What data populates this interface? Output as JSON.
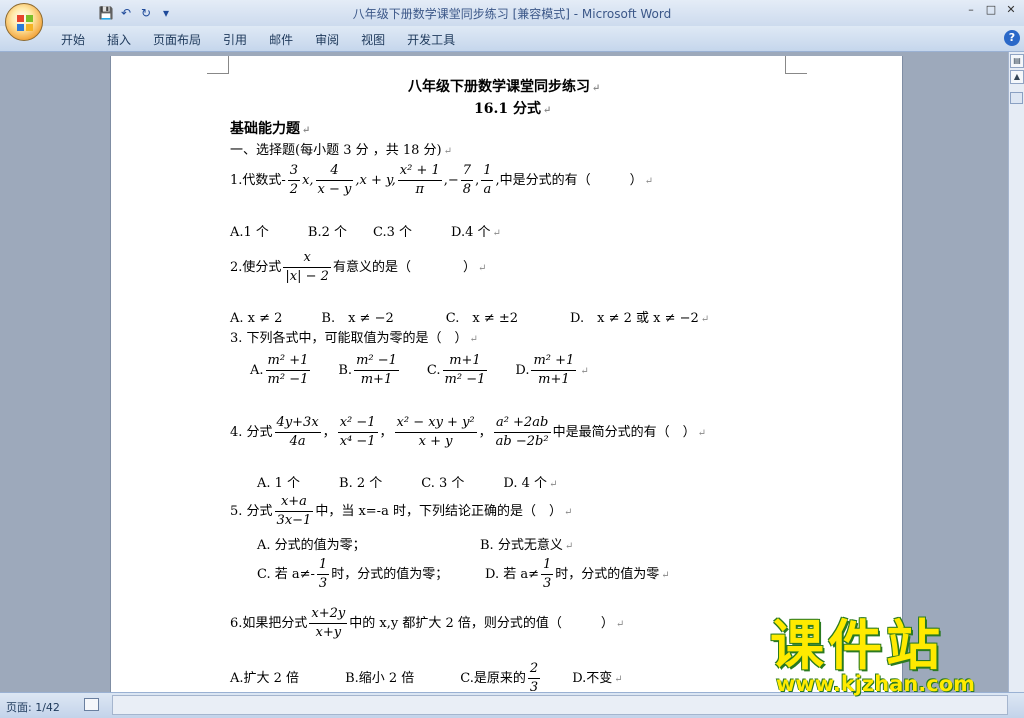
{
  "window": {
    "title": "八年级下册数学课堂同步练习 [兼容模式] - Microsoft Word",
    "controls": [
      "–",
      "□",
      "✕"
    ]
  },
  "qat": {
    "save_icon": "💾",
    "undo_icon": "↶",
    "redo_icon": "↻",
    "more_icon": "▾"
  },
  "ribbon": {
    "tabs": [
      "开始",
      "插入",
      "页面布局",
      "引用",
      "邮件",
      "审阅",
      "视图",
      "开发工具"
    ],
    "help": "?"
  },
  "status": {
    "page": "页面: 1/42"
  },
  "doc": {
    "mark": "↵",
    "title": "八年级下册数学课堂同步练习",
    "subtitle": "16.1 分式",
    "section": "基础能力题",
    "part1": "一、选择题(每小题 3 分 ，共 18 分)",
    "q1": {
      "prefix": "1.代数式-",
      "f1n": "3",
      "f1d": "2",
      "t1": "x,",
      "f2n": "4",
      "f2d": "x − y",
      "t2": ",x + y,",
      "f3n": "x² + 1",
      "f3d": "π",
      "t3": ",−",
      "f4n": "7",
      "f4d": "8",
      "t4": ",",
      "f5n": "1",
      "f5d": "a",
      "suffix": ",中是分式的有（　　　）"
    },
    "q1opts": "A.1 个　　　B.2 个　　C.3 个　　　D.4 个",
    "q2": {
      "prefix": "2.使分式",
      "fn": "x",
      "fd": "|x| − 2",
      "suffix": "有意义的是（　　　　）"
    },
    "q2opts": "A. x ≠ 2　　　B.　x ≠ −2　　　　C.　x ≠ ±2　　　　D.　x ≠ 2 或 x ≠ −2",
    "q3": "3. 下列各式中，可能取值为零的是（　）",
    "q3opts": {
      "a": "A.",
      "an": "m² +1",
      "ad": "m² −1",
      "b": "B.",
      "bn": "m² −1",
      "bd": "m+1",
      "c": "C.",
      "cn": "m+1",
      "cd": "m² −1",
      "d": "D.",
      "dn": "m² +1",
      "dd": "m+1"
    },
    "q4": {
      "prefix": "4. 分式",
      "f1n": "4y+3x",
      "f1d": "4a",
      "sep": "，",
      "f2n": "x² −1",
      "f2d": "x⁴ −1",
      "f3n": "x² − xy + y²",
      "f3d": "x + y",
      "f4n": "a² +2ab",
      "f4d": "ab −2b²",
      "suffix": "中是最简分式的有（　）"
    },
    "q4opts": "A. 1 个　　　B. 2 个　　　C. 3 个　　　D. 4 个",
    "q5": {
      "prefix": "5. 分式",
      "fn": "x+a",
      "fd": "3x−1",
      "suffix": "中，当 x=-a 时，下列结论正确的是（　）"
    },
    "q5a": "A. 分式的值为零；",
    "q5b": "B. 分式无意义",
    "q5c": {
      "pre": "C. 若 a≠-",
      "fn": "1",
      "fd": "3",
      "post": "时，分式的值为零；"
    },
    "q5d": {
      "pre": "D. 若 a≠",
      "fn": "1",
      "fd": "3",
      "post": "时，分式的值为零"
    },
    "q6": {
      "prefix": "6.如果把分式",
      "fn": "x+2y",
      "fd": "x+y",
      "suffix": "中的 x,y 都扩大 2 倍，则分式的值（　　　）"
    },
    "q6opts": {
      "a": "A.扩大 2 倍",
      "b": "B.缩小 2 倍",
      "c": "C.是原来的",
      "cn": "2",
      "cd": "3",
      "d": "D.不变"
    }
  },
  "watermark": {
    "text": "课件站",
    "url": "www.kjzhan.com"
  }
}
